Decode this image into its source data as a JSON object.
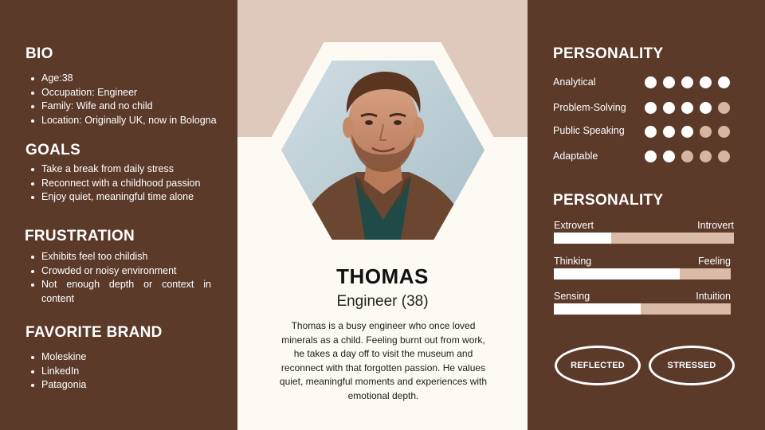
{
  "bio": {
    "title": "BIO",
    "items": [
      "Age:38",
      "Occupation:  Engineer",
      "Family: Wife and no child",
      "Location: Originally UK, now in Bologna"
    ]
  },
  "goals": {
    "title": "GOALS",
    "items": [
      "Take a break from daily stress",
      "Reconnect with a childhood passion",
      "Enjoy quiet, meaningful time alone"
    ]
  },
  "frustration": {
    "title": "FRUSTRATION",
    "items": [
      "Exhibits feel too childish",
      "Crowded or noisy environment",
      "Not enough depth or context in content"
    ]
  },
  "favorite_brand": {
    "title": "FAVORITE BRAND",
    "items": [
      "Moleskine",
      "LinkedIn",
      "Patagonia"
    ]
  },
  "profile": {
    "name": "THOMAS",
    "role": "Engineer (38)",
    "description": "Thomas is a busy engineer who once loved minerals as a child. Feeling burnt out from work, he takes a day off to visit the museum and reconnect with that forgotten passion. He values quiet, meaningful moments and experiences with emotional depth."
  },
  "personality_traits": {
    "title": "PERSONALITY",
    "max": 5,
    "traits": [
      {
        "label": "Analytical",
        "score": 5
      },
      {
        "label": "Problem-Solving",
        "score": 4
      },
      {
        "label": "Public Speaking",
        "score": 3
      },
      {
        "label": "Adaptable",
        "score": 2
      }
    ]
  },
  "personality_axes": {
    "title": "PERSONALITY",
    "axes": [
      {
        "left": "Extrovert",
        "right": "Introvert",
        "value": 0.32
      },
      {
        "left": "Thinking",
        "right": "Feeling",
        "value": 0.71
      },
      {
        "left": "Sensing",
        "right": "Intuition",
        "value": 0.49
      }
    ]
  },
  "moods": [
    "REFLECTED",
    "STRESSED"
  ],
  "colors": {
    "panel": "#5b3a2a",
    "center_bg": "#fdfaf3",
    "center_top": "#dec9bc",
    "dot_off": "#d6b6a0",
    "bar_track": "#d9bba7"
  }
}
